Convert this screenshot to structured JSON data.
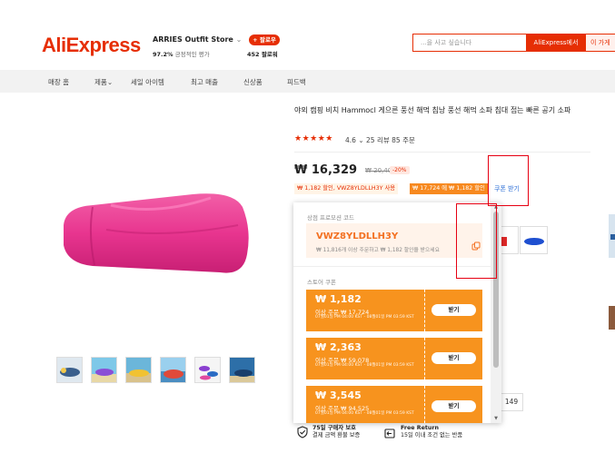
{
  "header": {
    "logo": "AliExpress",
    "store_name": "ARRIES Outfit Store",
    "store_caret": "⌄",
    "rating_percent": "97.2%",
    "rating_label": "긍정적인 평가",
    "follow_label": "+ 팔로우",
    "followers": "452 팔로워",
    "search_placeholder": "...을 사고 싶습니다",
    "search_button": "AliExpress에서",
    "store_search_button": "이 가게"
  },
  "nav": {
    "items": [
      "매장 홈",
      "제품",
      "세일 아이템",
      "최고 매출",
      "신상품",
      "피드백"
    ],
    "dropdown_caret": "⌄"
  },
  "product": {
    "title": "야외 캠핑 비치 Hammocl 게으른 풍선 해먹 침낭 풍선 해먹 소파 침대 접는 빠른 공기 소파",
    "stars": "★★★★★",
    "rating": "4.6",
    "rating_caret": "⌄",
    "reviews": "25 리뷰",
    "orders": "85 주문",
    "price": "₩ 16,329",
    "old_price": "₩ 20,406",
    "discount": "-20%",
    "coupon_tag_1": "₩ 1,182 할인, VWZ8YLDLLH3Y 사용",
    "coupon_tag_2": "₩ 17,724 에 ₩ 1,182 할인",
    "coupon_link": "쿠폰 받기",
    "quantity": "149"
  },
  "popup": {
    "promo_label": "상점 프로모션 코드",
    "code": "VWZ8YLDLLH3Y",
    "code_sub": "₩ 11,816개 이상 주문하고 ₩ 1,182 할인을 받으세요",
    "store_label": "스토어 쿠폰",
    "coupons": [
      {
        "amount": "₩ 1,182",
        "min": "이상 주문 ₩ 17,724",
        "date": "07월01일 PM 04:00 KST - 08월01일 PM 03:59 KST",
        "button": "받기"
      },
      {
        "amount": "₩ 2,363",
        "min": "이상 주문 ₩ 59,078",
        "date": "07월01일 PM 04:00 KST - 08월01일 PM 03:59 KST",
        "button": "받기"
      },
      {
        "amount": "₩ 3,545",
        "min": "이상 주문 ₩ 94,525",
        "date": "07월01일 PM 04:00 KST - 08월01일 PM 03:59 KST",
        "button": "받기"
      }
    ]
  },
  "guarantees": {
    "buyer_title": "75일 구매자 보호",
    "buyer_sub": "결제 금액 환불 보증",
    "return_title": "Free Return",
    "return_sub": "15일 이내 조건 없는 반품"
  },
  "colors": {
    "brand": "#e62e04",
    "coupon_orange": "#f7931e",
    "code_orange": "#f37021",
    "product_pink": "#e8358f",
    "highlight_red": "#e60012"
  },
  "icons": [
    "copy-icon",
    "shield-check-icon",
    "return-icon",
    "scroll-up-arrow-icon",
    "scroll-down-arrow-icon"
  ]
}
